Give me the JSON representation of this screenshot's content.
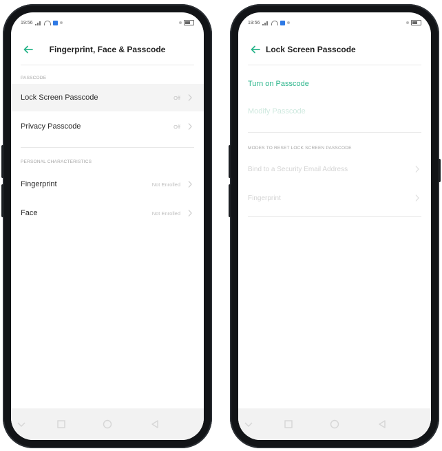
{
  "screen1": {
    "status_time": "19:56",
    "title": "Fingerprint, Face & Passcode",
    "section_passcode": "PASSCODE",
    "rows_passcode": [
      {
        "label": "Lock Screen Passcode",
        "value": "Off"
      },
      {
        "label": "Privacy Passcode",
        "value": "Off"
      }
    ],
    "section_personal": "PERSONAL CHARACTERISTICS",
    "rows_personal": [
      {
        "label": "Fingerprint",
        "value": "Not Enrolled"
      },
      {
        "label": "Face",
        "value": "Not Enrolled"
      }
    ]
  },
  "screen2": {
    "status_time": "19:56",
    "title": "Lock Screen Passcode",
    "turn_on": "Turn on Passcode",
    "modify": "Modify Passcode",
    "section_reset": "MODES TO RESET LOCK SCREEN PASSCODE",
    "rows_reset": [
      {
        "label": "Bind to a Security Email Address"
      },
      {
        "label": "Fingerprint"
      }
    ]
  },
  "icons": [
    "back-arrow-icon",
    "chevron-right-icon",
    "signal-icon",
    "wifi-icon",
    "battery-icon",
    "nav-menu-icon",
    "nav-home-icon",
    "nav-back-icon"
  ],
  "colors": {
    "accent": "#2bb58b",
    "text": "#2a2a2a",
    "muted": "#bfbfbf",
    "frame": "#121417"
  }
}
